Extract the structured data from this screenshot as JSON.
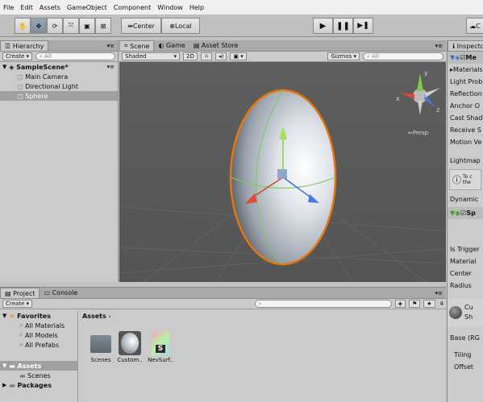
{
  "menu": [
    "File",
    "Edit",
    "Assets",
    "GameObject",
    "Component",
    "Window",
    "Help"
  ],
  "toolbar": {
    "center_label": "Center",
    "local_label": "Local",
    "cloud_label": "C"
  },
  "hierarchy": {
    "tab_label": "Hierarchy",
    "create_label": "Create",
    "search_placeholder": "All",
    "scene_name": "SampleScene*",
    "items": [
      {
        "label": "Main Camera"
      },
      {
        "label": "Directional Light"
      },
      {
        "label": "Sphere"
      }
    ]
  },
  "scene": {
    "tabs": [
      {
        "label": "Scene"
      },
      {
        "label": "Game"
      },
      {
        "label": "Asset Store"
      }
    ],
    "shading_label": "Shaded",
    "mode_2d": "2D",
    "gizmos_label": "Gizmos",
    "search_placeholder": "All",
    "persp_label": "Persp",
    "axis_y": "y",
    "axis_x": "x",
    "axis_z": "z"
  },
  "inspector": {
    "tab_label": "Inspector",
    "component_title": "Me",
    "rows": [
      {
        "label": "Materials"
      },
      {
        "label": "Light Prob"
      },
      {
        "label": "Reflection"
      },
      {
        "label": "Anchor O"
      },
      {
        "label": "Cast Shad"
      },
      {
        "label": "Receive S"
      },
      {
        "label": "Motion Ve"
      }
    ],
    "lightmap_label": "Lightmap",
    "info_text_1": "To c",
    "info_text_2": "the",
    "dynamic_label": "Dynamic",
    "collider_title": "Sp",
    "collider_rows": [
      {
        "label": "Is Trigger"
      },
      {
        "label": "Material"
      },
      {
        "label": "Center"
      },
      {
        "label": "Radius"
      }
    ],
    "material_name": "Cu",
    "material_sub": "Sh",
    "base_label": "Base (RG",
    "tiling_label": "Tiling",
    "offset_label": "Offset"
  },
  "project": {
    "tab_label": "Project",
    "console_label": "Console",
    "create_label": "Create",
    "favorites_label": "Favorites",
    "favorites": [
      {
        "label": "All Materials"
      },
      {
        "label": "All Models"
      },
      {
        "label": "All Prefabs"
      }
    ],
    "assets_label": "Assets",
    "assets_children": [
      {
        "label": "Scenes"
      }
    ],
    "packages_label": "Packages",
    "breadcrumb": "Assets",
    "badge_count": "4",
    "asset_items": [
      {
        "label": "Scenes"
      },
      {
        "label": "Custom.."
      },
      {
        "label": "NevSurf.."
      }
    ],
    "shader_letter": "S"
  }
}
